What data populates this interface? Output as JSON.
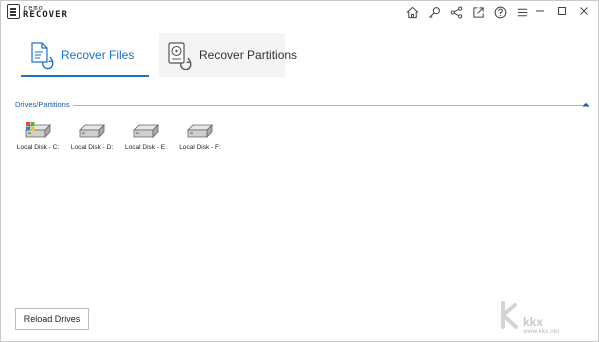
{
  "app": {
    "logo_line1": "remo",
    "logo_line2": "RECOVER"
  },
  "toolbar": {
    "icons": [
      "home-icon",
      "key-icon",
      "share-icon",
      "external-link-icon",
      "help-icon",
      "menu-icon"
    ]
  },
  "window_controls": [
    "minimize-icon",
    "maximize-icon",
    "close-icon"
  ],
  "tabs": [
    {
      "label": "Recover Files",
      "active": true
    },
    {
      "label": "Recover Partitions",
      "active": false
    }
  ],
  "drives_section": {
    "title": "Drives/Partitions",
    "drives": [
      {
        "label": "Local Disk - C:",
        "icon": "system-drive-icon"
      },
      {
        "label": "Local Disk - D:",
        "icon": "drive-icon"
      },
      {
        "label": "Local Disk - E:",
        "icon": "drive-icon"
      },
      {
        "label": "Local Disk - F:",
        "icon": "drive-icon"
      }
    ]
  },
  "footer": {
    "reload_label": "Reload Drives"
  },
  "watermark": {
    "text": "kkx",
    "url": "www.kkx.net"
  },
  "colors": {
    "accent": "#1a73c9",
    "section": "#1a5ea8"
  }
}
